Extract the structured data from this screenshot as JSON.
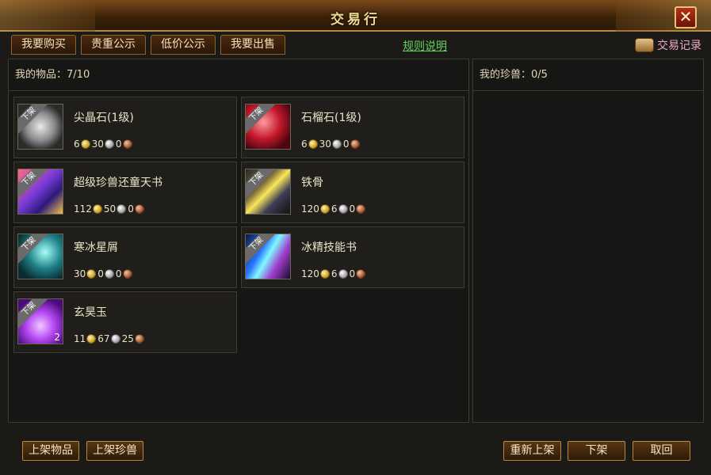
{
  "window": {
    "title": "交易行",
    "close_label": "✕"
  },
  "tabs": [
    "我要购买",
    "贵重公示",
    "低价公示",
    "我要出售"
  ],
  "rules_link": "规则说明",
  "trade_record": "交易记录",
  "left_panel": {
    "header_label": "我的物品：",
    "header_count": "7/10"
  },
  "right_panel": {
    "header_label": "我的珍兽：",
    "header_count": "0/5"
  },
  "items": [
    {
      "name": "尖晶石(1级)",
      "badge": "下架",
      "stack": "",
      "icon": "spinel-gem-icon",
      "gold": "6",
      "silver": "30",
      "copper": "0"
    },
    {
      "name": "石榴石(1级)",
      "badge": "下架",
      "stack": "",
      "icon": "garnet-gem-icon",
      "gold": "6",
      "silver": "30",
      "copper": "0"
    },
    {
      "name": "超级珍兽还童天书",
      "badge": "下架",
      "stack": "",
      "icon": "pet-rejuvenation-book-icon",
      "gold": "112",
      "silver": "50",
      "copper": "0"
    },
    {
      "name": "铁骨",
      "badge": "下架",
      "stack": "",
      "icon": "iron-bone-icon",
      "gold": "120",
      "silver": "6",
      "copper": "0"
    },
    {
      "name": "寒冰星屑",
      "badge": "下架",
      "stack": "",
      "icon": "frost-stardust-icon",
      "gold": "30",
      "silver": "0",
      "copper": "0"
    },
    {
      "name": "冰精技能书",
      "badge": "下架",
      "stack": "",
      "icon": "ice-skill-book-icon",
      "gold": "120",
      "silver": "6",
      "copper": "0"
    },
    {
      "name": "玄昊玉",
      "badge": "下架",
      "stack": "2",
      "icon": "xuanhao-jade-icon",
      "gold": "11",
      "silver": "67",
      "copper": "25"
    }
  ],
  "buttons": {
    "list_item": "上架物品",
    "list_pet": "上架珍兽",
    "relist": "重新上架",
    "delist": "下架",
    "cancel": "取回"
  }
}
